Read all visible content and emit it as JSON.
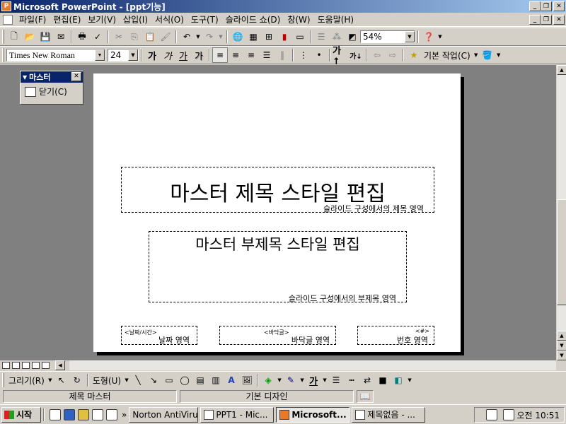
{
  "window": {
    "title": "Microsoft PowerPoint - [ppt기능]",
    "app_icon_letter": "P",
    "btn_minimize": "_",
    "btn_restore": "❐",
    "btn_close": "✕"
  },
  "menubar": {
    "items": [
      "파일(F)",
      "편집(E)",
      "보기(V)",
      "삽입(I)",
      "서식(O)",
      "도구(T)",
      "슬라이드 쇼(D)",
      "창(W)",
      "도움말(H)"
    ]
  },
  "standard_toolbar": {
    "zoom": "54%"
  },
  "format_toolbar": {
    "font": "Times New Roman",
    "size": "24",
    "common_tasks": "기본 작업(C)"
  },
  "master_toolbar": {
    "title": "마스터",
    "close_label": "닫기(C)"
  },
  "slide": {
    "title_text": "마스터 제목 스타일 편집",
    "title_caption": "슬라이드 구성에서의 제목 영역",
    "subtitle_text": "마스터 부제목 스타일 편집",
    "subtitle_caption": "슬라이드 구성에서의 부제목 영역",
    "date_tag": "<날짜/시간>",
    "date_caption": "날짜 영역",
    "footer_tag": "<바닥글>",
    "footer_caption": "바닥글 영역",
    "number_tag": "<#>",
    "number_caption": "번호 영역"
  },
  "drawing_toolbar": {
    "draw_label": "그리기(R)",
    "shapes_label": "도형(U)"
  },
  "statusbar": {
    "panel1": "제목 마스터",
    "panel2": "기본 디자인"
  },
  "taskbar": {
    "start": "시작",
    "overflow": "»",
    "tasks": [
      "Norton AntiVirus",
      "PPT1 - Mic...",
      "Microsoft...",
      "제목없음 - ..."
    ],
    "clock": "오전 10:51"
  }
}
